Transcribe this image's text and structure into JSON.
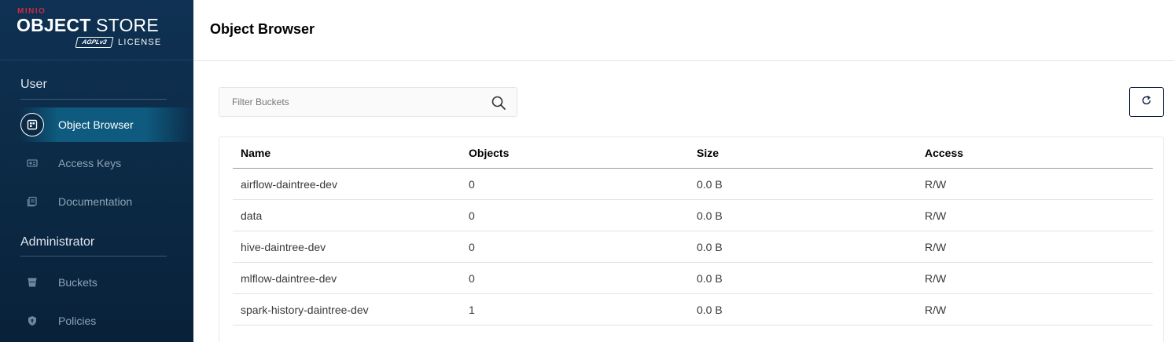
{
  "logo": {
    "brand": "MINIO",
    "product_bold": "OBJECT",
    "product_rest": " STORE",
    "badge": "AGPLv3",
    "license": "LICENSE"
  },
  "sidebar": {
    "sections": [
      {
        "title": "User",
        "items": [
          {
            "label": "Object Browser",
            "icon": "object-browser-icon",
            "active": true
          },
          {
            "label": "Access Keys",
            "icon": "access-keys-icon",
            "active": false
          },
          {
            "label": "Documentation",
            "icon": "documentation-icon",
            "active": false
          }
        ]
      },
      {
        "title": "Administrator",
        "items": [
          {
            "label": "Buckets",
            "icon": "buckets-icon",
            "active": false
          },
          {
            "label": "Policies",
            "icon": "policies-icon",
            "active": false
          }
        ]
      }
    ]
  },
  "header": {
    "title": "Object Browser"
  },
  "filter": {
    "placeholder": "Filter Buckets",
    "value": ""
  },
  "table": {
    "columns": [
      "Name",
      "Objects",
      "Size",
      "Access"
    ],
    "rows": [
      [
        "airflow-daintree-dev",
        "0",
        "0.0 B",
        "R/W"
      ],
      [
        "data",
        "0",
        "0.0 B",
        "R/W"
      ],
      [
        "hive-daintree-dev",
        "0",
        "0.0 B",
        "R/W"
      ],
      [
        "mlflow-daintree-dev",
        "0",
        "0.0 B",
        "R/W"
      ],
      [
        "spark-history-daintree-dev",
        "1",
        "0.0 B",
        "R/W"
      ]
    ]
  },
  "colors": {
    "sidebar_bg": "#0c2b47",
    "active_item": "#0e5b7f",
    "brand_red": "#c72c48",
    "refresh_border": "#07193e"
  }
}
